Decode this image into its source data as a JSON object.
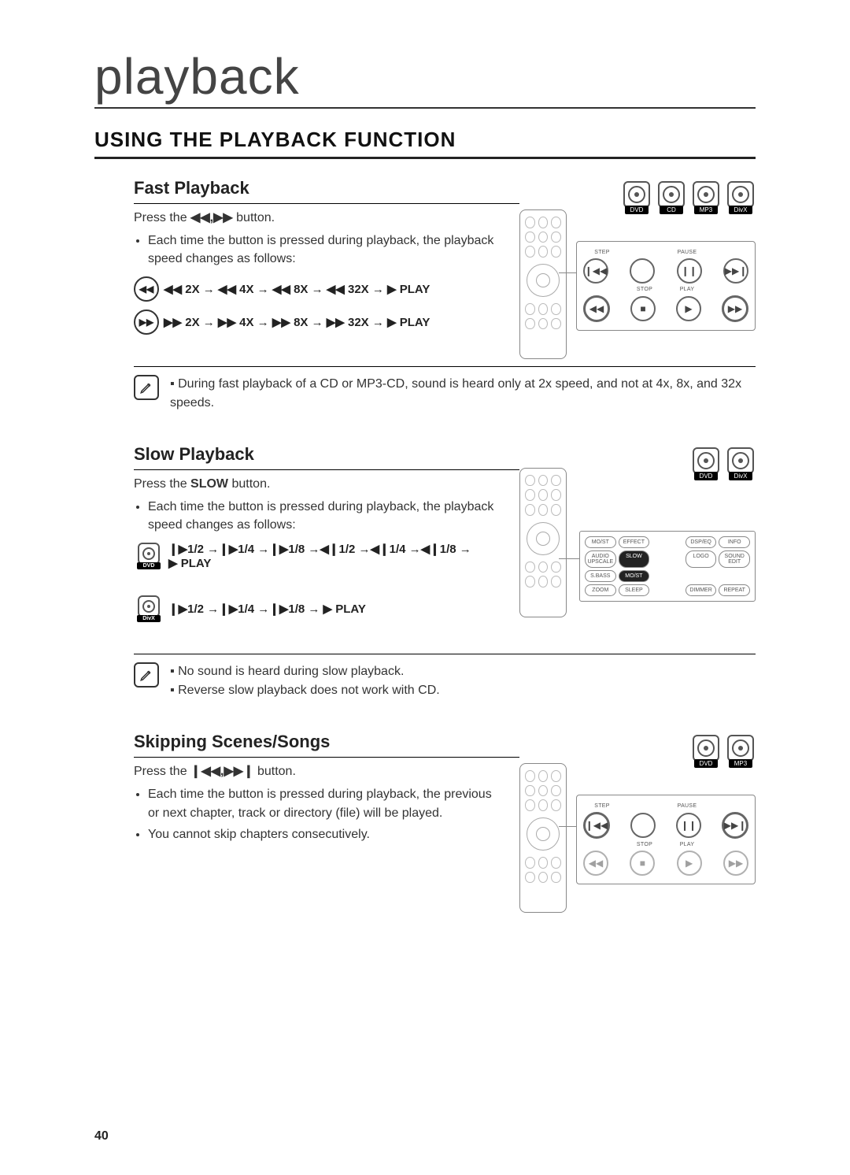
{
  "page": {
    "chapter": "playback",
    "section": "USING THE PLAYBACK FUNCTION",
    "number": "40"
  },
  "badges": {
    "dvd": "DVD",
    "cd": "CD",
    "mp3": "MP3",
    "divx": "DivX"
  },
  "fast": {
    "heading": "Fast Playback",
    "press_prefix": "Press the ",
    "press_suffix": " button.",
    "press_icons": "◀◀,▶▶",
    "bullet1": "Each time the button is pressed during playback, the playback speed changes as follows:",
    "rew_line": "◀◀ 2X → ◀◀ 4X → ◀◀ 8X → ◀◀ 32X → ▶ PLAY",
    "ff_line": "▶▶ 2X → ▶▶ 4X → ▶▶ 8X → ▶▶ 32X → ▶ PLAY",
    "note": "During fast playback of a CD or MP3-CD, sound is heard only at 2x speed, and not at 4x, 8x, and 32x speeds.",
    "callout": {
      "row1_labels": [
        "STEP",
        "",
        "PAUSE",
        ""
      ],
      "row2_labels": [
        "",
        "STOP",
        "PLAY",
        ""
      ]
    }
  },
  "slow": {
    "heading": "Slow Playback",
    "press_prefix": "Press the ",
    "slow_word": "SLOW",
    "press_suffix": " button.",
    "bullet1": "Each time the button is pressed during playback, the playback speed changes as follows:",
    "dvd_line": "❙▶1/2 →❙▶1/4 →❙▶1/8 →◀❙1/2 →◀❙1/4 →◀❙1/8 →",
    "dvd_play": "▶ PLAY",
    "divx_line": "❙▶1/2 →❙▶1/4 →❙▶1/8 → ▶ PLAY",
    "note1": "No sound is heard during slow playback.",
    "note2": "Reverse slow playback does not work with CD.",
    "callout_chips": {
      "row1": [
        "MO/ST",
        "EFFECT",
        "",
        "DSP/EQ",
        "INFO"
      ],
      "row2": [
        "AUDIO UPSCALE",
        "SLOW",
        "",
        "LOGO",
        "SOUND EDIT"
      ],
      "row3": [
        "S.BASS",
        "MO/ST",
        "",
        "",
        ""
      ],
      "row4": [
        "ZOOM",
        "SLEEP",
        "",
        "DIMMER",
        "REPEAT"
      ]
    }
  },
  "skip": {
    "heading": "Skipping Scenes/Songs",
    "press_prefix": "Press the ",
    "press_icons": "❙◀◀,▶▶❙",
    "press_suffix": " button.",
    "bullet1": "Each time the button is pressed during playback, the previous or next chapter, track or directory (file) will be played.",
    "bullet2": "You cannot skip chapters consecutively.",
    "callout": {
      "row1_labels": [
        "STEP",
        "",
        "PAUSE",
        ""
      ],
      "row2_labels": [
        "",
        "STOP",
        "PLAY",
        ""
      ]
    }
  }
}
